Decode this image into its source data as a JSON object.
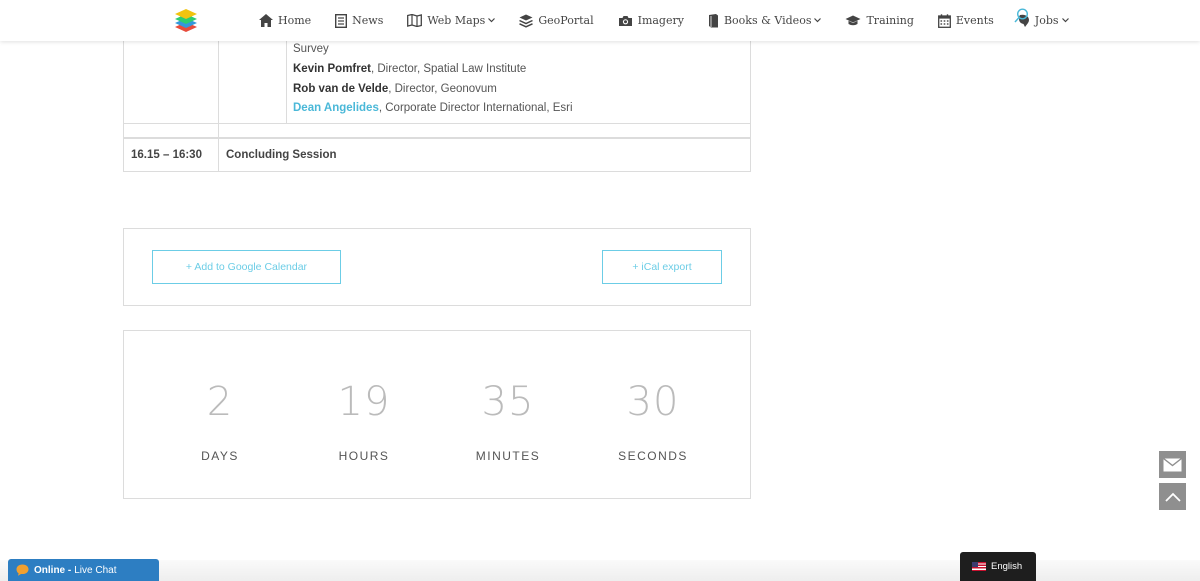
{
  "nav": {
    "items": [
      {
        "label": "Home",
        "icon": "home-icon"
      },
      {
        "label": "News",
        "icon": "news-icon"
      },
      {
        "label": "Web Maps",
        "icon": "map-icon",
        "dropdown": true
      },
      {
        "label": "GeoPortal",
        "icon": "layers-icon"
      },
      {
        "label": "Imagery",
        "icon": "camera-icon"
      },
      {
        "label": "Books & Videos",
        "icon": "book-icon",
        "dropdown": true
      },
      {
        "label": "Training",
        "icon": "graduation-cap-icon"
      },
      {
        "label": "Events",
        "icon": "calendar-icon"
      },
      {
        "label": "Jobs",
        "icon": "briefcase-icon",
        "dropdown": true
      }
    ]
  },
  "schedule": {
    "partial_line": "Survey",
    "speakers": [
      {
        "name": "Kevin Pomfret",
        "role": ", Director, Spatial Law Institute",
        "highlight": false
      },
      {
        "name": "Rob van de Velde",
        "role": ", Director, Geonovum",
        "highlight": false
      },
      {
        "name": "Dean Angelides",
        "role": ", Corporate Director International, Esri",
        "highlight": true
      }
    ],
    "last_row": {
      "time": "16.15 – 16:30",
      "session": "Concluding Session"
    }
  },
  "calendar": {
    "google_label": "+ Add to Google Calendar",
    "ical_label": "+ iCal export"
  },
  "countdown": {
    "days": {
      "value": "2",
      "label": "DAYS"
    },
    "hours": {
      "value": "19",
      "label": "HOURS"
    },
    "minutes": {
      "value": "35",
      "label": "MINUTES"
    },
    "seconds": {
      "value": "30",
      "label": "SECONDS"
    }
  },
  "chat": {
    "status": "Online -",
    "label": "Live Chat"
  },
  "language": {
    "label": "English"
  },
  "colors": {
    "accent": "#6ccde6",
    "link": "#4ab8d8",
    "chat": "#2d7ec2"
  }
}
